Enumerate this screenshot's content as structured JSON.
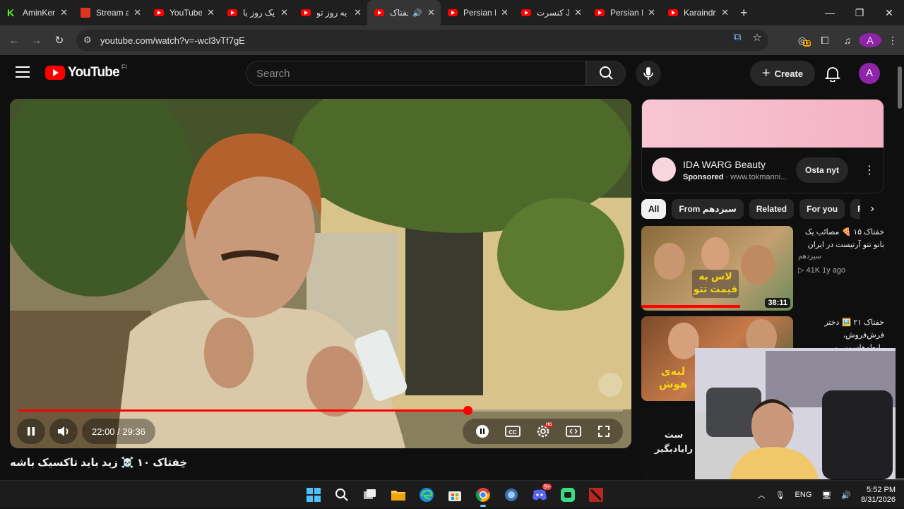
{
  "browser": {
    "tabs": [
      {
        "title": "AminKer",
        "favicon": "kick-icon"
      },
      {
        "title": "Stream a",
        "favicon": "stream-icon"
      },
      {
        "title": "YouTube",
        "favicon": "youtube-icon"
      },
      {
        "title": "یک روز با",
        "favicon": "youtube-icon"
      },
      {
        "title": "به روز تو",
        "favicon": "youtube-icon"
      },
      {
        "title": "خفتاک",
        "favicon": "youtube-icon",
        "active": true
      },
      {
        "title": "Persian I",
        "favicon": "youtube-icon"
      },
      {
        "title": "کنسرت J",
        "favicon": "youtube-icon"
      },
      {
        "title": "Persian I",
        "favicon": "youtube-icon"
      },
      {
        "title": "Karaindn",
        "favicon": "youtube-icon"
      }
    ],
    "url": "youtube.com/watch?v=-wcl3vTf7gE",
    "extension_badge": "13",
    "profile_initial": "A"
  },
  "youtube": {
    "logo_text": "YouTube",
    "country_code": "FI",
    "search_placeholder": "Search",
    "create_label": "Create",
    "avatar_initial": "A"
  },
  "player": {
    "time_current": "22:00",
    "time_total": "29:36",
    "time_display": "22:00 / 29:36",
    "progress": 0.743,
    "hd_badge": "HD"
  },
  "video_title": "خِفتاک ۱۰ ☠️ زید باید تاکسیک باشه",
  "ad": {
    "brand": "IDA WARG Beauty",
    "sponsored": "Sponsored",
    "domain": "· www.tokmanni...",
    "cta": "Osta nyt",
    "colors": {
      "banner": "#f4b8c8"
    }
  },
  "chips": [
    "All",
    "From سیزدهم",
    "Related",
    "For you",
    "R"
  ],
  "recommendations": [
    {
      "title": "خفتاک ۱۵ 🍕 مصائب یک بانو تتو آرتیست در ایران",
      "channel": "سیزدهم",
      "views": "41K",
      "age": "1y ago",
      "meta": "▷ 41K   1y ago",
      "duration": "38:11",
      "thumb_text": "لاس به قیمت تتو"
    },
    {
      "title": "خفتاک ۲۱ 🖼️ دختر فرش‌فروش، رابطه‌هاسون، و",
      "thumb_text": "لبه‌ی هوش"
    },
    {
      "thumb_text": "ست رایادبگیر"
    }
  ],
  "taskbar": {
    "lang": "ENG",
    "time": "5:52 PM",
    "date": "8/31/2026",
    "discord_badge": "9+"
  }
}
